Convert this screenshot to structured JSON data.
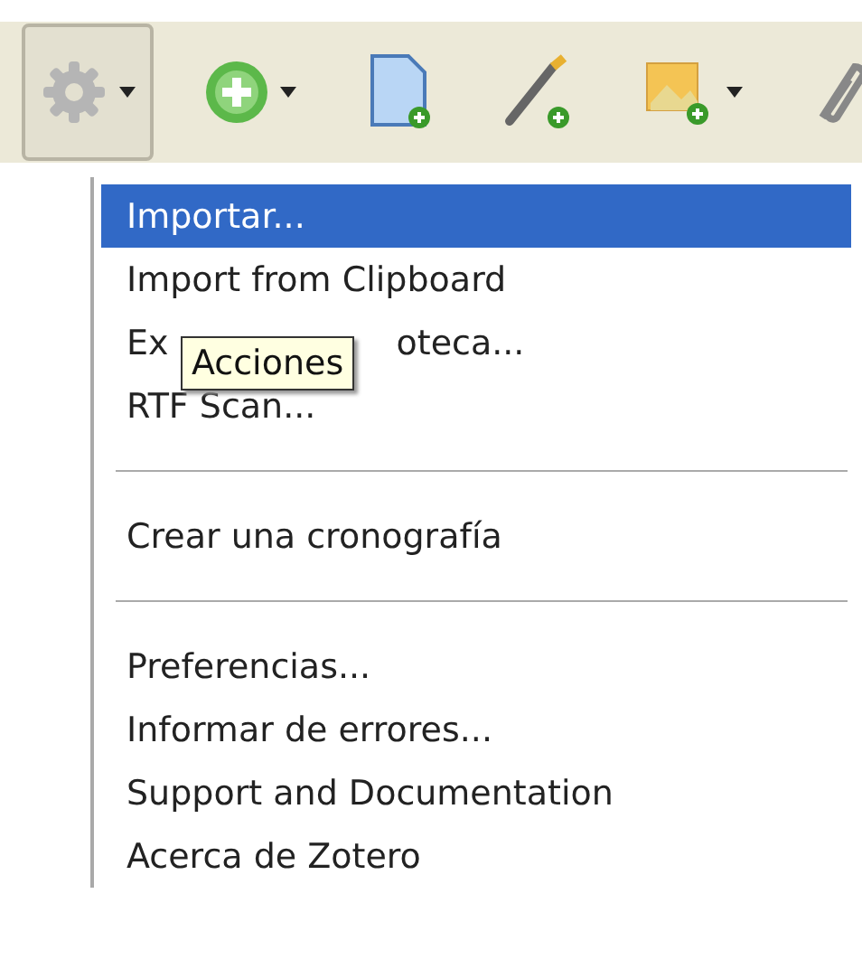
{
  "toolbar": {
    "buttons": [
      {
        "kind": "gear",
        "dropdown": true,
        "pressed": true
      },
      {
        "kind": "add",
        "dropdown": true,
        "pressed": false
      },
      {
        "kind": "document",
        "dropdown": false,
        "pressed": false
      },
      {
        "kind": "wand",
        "dropdown": false,
        "pressed": false
      },
      {
        "kind": "image",
        "dropdown": true,
        "pressed": false
      },
      {
        "kind": "clip",
        "dropdown": false,
        "pressed": false
      }
    ]
  },
  "menu": {
    "groups": [
      [
        {
          "label": "Importar...",
          "selected": true
        },
        {
          "label": "Import from Clipboard",
          "selected": false
        },
        {
          "label": "Ex",
          "label_after": "oteca...",
          "selected": false
        },
        {
          "label": "RTF Scan...",
          "selected": false
        }
      ],
      [
        {
          "label": "Crear una cronografía",
          "selected": false
        }
      ],
      [
        {
          "label": "Preferencias...",
          "selected": false
        },
        {
          "label": "Informar de errores...",
          "selected": false
        },
        {
          "label": "Support and Documentation",
          "selected": false
        },
        {
          "label": "Acerca de Zotero",
          "selected": false
        }
      ]
    ]
  },
  "tooltip": {
    "text": "Acciones"
  }
}
